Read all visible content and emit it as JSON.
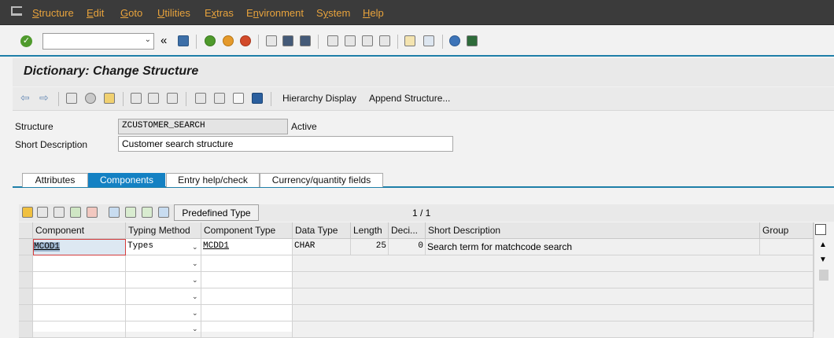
{
  "menu": [
    {
      "label": "Structure",
      "u": "S"
    },
    {
      "label": "Edit",
      "u": "E"
    },
    {
      "label": "Goto",
      "u": "G"
    },
    {
      "label": "Utilities",
      "u": "U"
    },
    {
      "label": "Extras",
      "u": "x"
    },
    {
      "label": "Environment",
      "u": "n"
    },
    {
      "label": "System",
      "u": "y"
    },
    {
      "label": "Help",
      "u": "H"
    }
  ],
  "toolbar": {
    "back_symbol": "«",
    "ok_symbol": "✓",
    "dd_symbol": "⌄"
  },
  "title": "Dictionary: Change Structure",
  "appbar": {
    "hierarchy": "Hierarchy Display",
    "append": "Append Structure..."
  },
  "header": {
    "structure_label": "Structure",
    "structure_value": "ZCUSTOMER_SEARCH",
    "status": "Active",
    "shortdesc_label": "Short Description",
    "shortdesc_value": "Customer search structure"
  },
  "tabs": [
    {
      "label": "Attributes"
    },
    {
      "label": "Components"
    },
    {
      "label": "Entry help/check"
    },
    {
      "label": "Currency/quantity fields"
    }
  ],
  "table": {
    "predefined_type": "Predefined Type",
    "pager": "1  /  1",
    "columns": [
      "Component",
      "Typing Method",
      "Component Type",
      "Data Type",
      "Length",
      "Deci...",
      "Short Description",
      "Group"
    ],
    "row1": {
      "component": "MCOD1",
      "typing": "Types",
      "ctype": "MCDD1",
      "dtype": "CHAR",
      "length": "25",
      "deci": "0",
      "desc": "Search term for matchcode search",
      "group": ""
    }
  },
  "colors": {
    "accent": "#1481c3",
    "menubar": "#3b3b3b",
    "menutext": "#e8a33c"
  }
}
